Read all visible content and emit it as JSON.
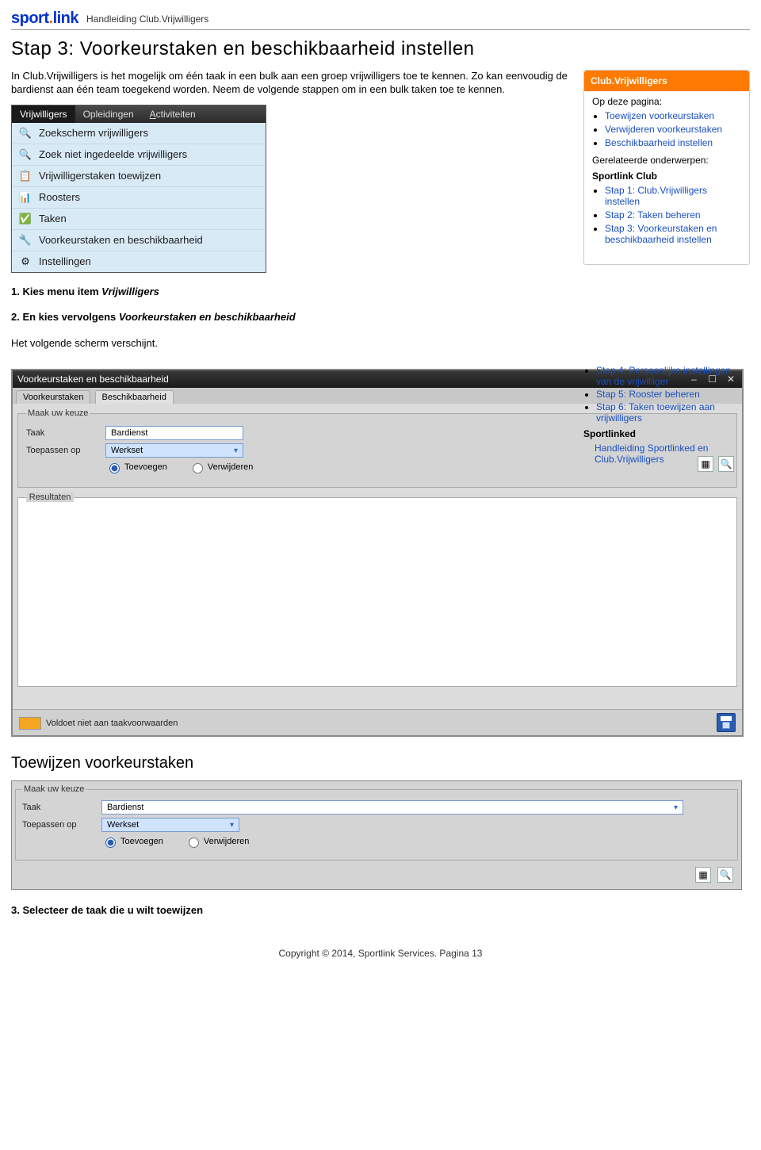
{
  "header": {
    "logo_part1": "sport",
    "logo_dot": ".",
    "logo_part2": "link",
    "subtitle": "Handleiding Club.Vrijwilligers"
  },
  "title": "Stap 3: Voorkeurstaken en beschikbaarheid instellen",
  "intro": "In Club.Vrijwilligers is het mogelijk om één taak in een bulk aan een groep vrijwilligers toe te kennen. Zo kan eenvoudig de bardienst aan één team toegekend worden. Neem de volgende stappen om in een bulk taken toe te kennen.",
  "menu": {
    "tabs": {
      "t1": "Vrijwilligers",
      "t2": "Opleidingen",
      "t3_pre": "A",
      "t3_rest": "ctiviteiten"
    },
    "items": [
      {
        "icon": "🔍",
        "label": "Zoekscherm vrijwilligers"
      },
      {
        "icon": "🔍",
        "label": "Zoek niet ingedeelde vrijwilligers"
      },
      {
        "icon": "📋",
        "label": "Vrijwilligerstaken toewijzen"
      },
      {
        "icon": "📊",
        "label": "Roosters"
      },
      {
        "icon": "✅",
        "label": "Taken"
      },
      {
        "icon": "🔧",
        "label": "Voorkeurstaken en beschikbaarheid"
      },
      {
        "icon": "⚙",
        "label": "Instellingen"
      }
    ]
  },
  "steps": {
    "s1a": "1. Kies menu item ",
    "s1b": "Vrijwilligers",
    "s2a": "2. En kies vervolgens ",
    "s2b": "Voorkeurstaken en beschikbaarheid",
    "after": "Het volgende scherm verschijnt."
  },
  "infobox": {
    "hdr": "Club.Vrijwilligers",
    "op": "Op deze pagina:",
    "bul1": "Toewijzen voorkeurstaken",
    "bul2": "Verwijderen voorkeurstaken",
    "bul3": "Beschikbaarheid instellen",
    "rel": "Gerelateerde onderwerpen:",
    "sc": "Sportlink Club",
    "steps": [
      "Stap 1: Club.Vrijwilligers instellen",
      "Stap 2: Taken beheren",
      "Stap 3: Voorkeurstaken en beschikbaarheid instellen",
      "Stap 4: Persoonlijke instellingen van de vrijwilliger",
      "Stap 5: Rooster beheren",
      "Stap 6: Taken toewijzen aan vrijwilligers"
    ],
    "sl": "Sportlinked",
    "hand": "Handleiding Sportlinked en Club.Vrijwilligers"
  },
  "dialog": {
    "title": "Voorkeurstaken en beschikbaarheid",
    "tab1": "Voorkeurstaken",
    "tab2": "Beschikbaarheid",
    "legend": "Maak uw keuze",
    "taak": "Taak",
    "taak_val": "Bardienst",
    "toe": "Toepassen op",
    "toe_val": "Werkset",
    "radio1": "Toevoegen",
    "radio2": "Verwijderen",
    "res": "Resultaten",
    "status": "Voldoet niet aan taakvoorwaarden"
  },
  "subhead": "Toewijzen voorkeurstaken",
  "smallform": {
    "legend": "Maak uw keuze",
    "taak": "Taak",
    "taak_val": "Bardienst",
    "toe": "Toepassen op",
    "toe_val": "Werkset",
    "radio1": "Toevoegen",
    "radio2": "Verwijderen"
  },
  "step3": "3. Selecteer de taak die u wilt toewijzen",
  "footer": "Copyright © 2014, Sportlink Services. Pagina 13"
}
